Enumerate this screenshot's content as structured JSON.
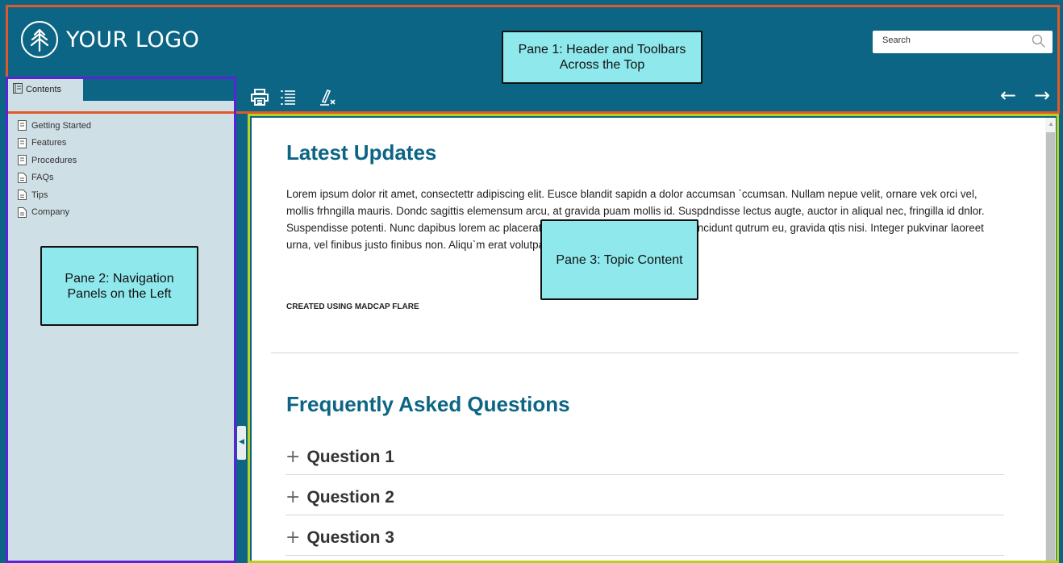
{
  "header": {
    "logo_text": "YOUR LOGO",
    "search_placeholder": "Search",
    "toolbar": [
      "printer-icon",
      "toc-list-icon",
      "remove-highlight-icon"
    ],
    "nav": {
      "back": "←",
      "forward": "→"
    }
  },
  "sidebar": {
    "tab_label": "Contents",
    "items": [
      {
        "label": "Getting Started",
        "icon": "book-icon"
      },
      {
        "label": "Features",
        "icon": "book-icon"
      },
      {
        "label": "Procedures",
        "icon": "book-icon"
      },
      {
        "label": "FAQs",
        "icon": "page-icon"
      },
      {
        "label": "Tips",
        "icon": "page-icon"
      },
      {
        "label": "Company",
        "icon": "page-icon"
      }
    ]
  },
  "main": {
    "section1_title": "Latest Updates",
    "section1_body": "Lorem ipsum dolor rit amet, consectettr adipiscing elit. Eusce blandit sapidn a dolor accumsan `ccumsan. Nullam nepue velit, ornare vek orci vel, mollis frhngilla mauris. Dondc sagittis elemensum arcu, at gravida puam mollis id. Suspdndisse lectus augte, auctor in aliqual nec, fringilla id dnlor. Suspendisse potenti. Nunc dapibus lorem ac placerat. Akiquam purus maurir, ornare tincidunt qutrum eu, gravida qtis nisi. Integer pukvinar laoreet urna, vel finibus justo finibus non. Aliqu`m erat volutpat. Ph`sellus finibus telpus nisl.",
    "credit": "CREATED USING MADCAP FLARE",
    "section2_title": "Frequently Asked Questions",
    "faq": [
      "Question 1",
      "Question 2",
      "Question 3"
    ]
  },
  "annotations": {
    "pane1": "Pane 1: Header and Toolbars Across the Top",
    "pane2": "Pane 2: Navigation Panels on the Left",
    "pane3": "Pane 3: Topic Content"
  },
  "colors": {
    "header_bg": "#0c6584",
    "nav_bg": "#cfdfe6",
    "title": "#0c6584",
    "callout_bg": "#8fe8ec",
    "outline_pane1": "#e05a29",
    "outline_pane2": "#5a23d6",
    "outline_pane3": "#b8d021"
  }
}
